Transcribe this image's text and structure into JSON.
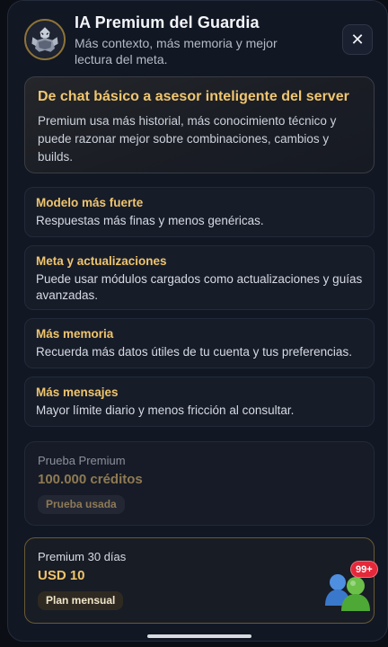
{
  "header": {
    "title": "IA Premium del Guardia",
    "subtitle": "Más contexto, más memoria y mejor lectura del meta.",
    "close_label": "✕"
  },
  "hero": {
    "title": "De chat básico a asesor inteligente del server",
    "text": "Premium usa más historial, más conocimiento técnico y puede razonar mejor sobre combinaciones, cambios y builds."
  },
  "features": [
    {
      "title": "Modelo más fuerte",
      "text": "Respuestas más finas y menos genéricas."
    },
    {
      "title": "Meta y actualizaciones",
      "text": "Puede usar módulos cargados como actualizaciones y guías avanzadas."
    },
    {
      "title": "Más memoria",
      "text": "Recuerda más datos útiles de tu cuenta y tus preferencias."
    },
    {
      "title": "Más mensajes",
      "text": "Mayor límite diario y menos fricción al consultar."
    }
  ],
  "plans": {
    "trial": {
      "name": "Prueba Premium",
      "price": "100.000 créditos",
      "badge": "Prueba usada"
    },
    "monthly": {
      "name": "Premium 30 días",
      "price": "USD 10",
      "badge": "Plan mensual"
    }
  },
  "notification": {
    "count": "99+"
  },
  "colors": {
    "accent": "#f0c670",
    "background": "#121724",
    "notification": "#e5283a"
  }
}
